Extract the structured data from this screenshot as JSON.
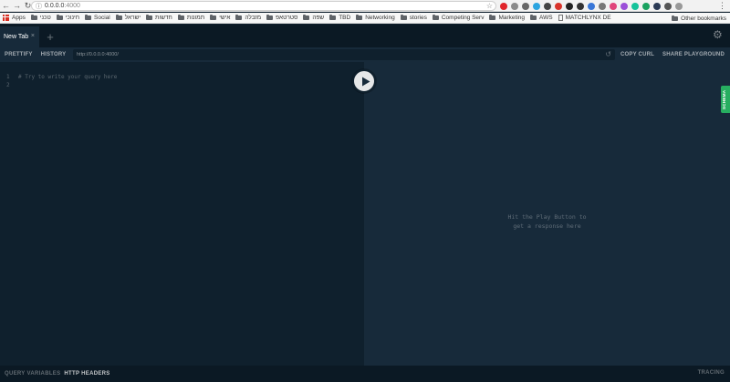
{
  "browser": {
    "url_host": "0.0.0.0",
    "url_port": ":4000",
    "extensions": [
      {
        "name": "opera-icon",
        "color": "#e0242a"
      },
      {
        "name": "ext-gray-icon",
        "color": "#8a8a8a"
      },
      {
        "name": "ext-gear-icon",
        "color": "#666666"
      },
      {
        "name": "telegram-icon",
        "color": "#2ca5e0"
      },
      {
        "name": "ext-dark-icon",
        "color": "#444444"
      },
      {
        "name": "ext-red-icon",
        "color": "#d9342b"
      },
      {
        "name": "ext-black-icon",
        "color": "#222222"
      },
      {
        "name": "ext-black2-icon",
        "color": "#333333"
      },
      {
        "name": "ext-blue-icon",
        "color": "#3a77d8"
      },
      {
        "name": "ext-gray2-icon",
        "color": "#777777"
      },
      {
        "name": "ext-pink-icon",
        "color": "#e0457b"
      },
      {
        "name": "ext-purple-icon",
        "color": "#9b4fd8"
      },
      {
        "name": "grammarly-icon",
        "color": "#15c39a"
      },
      {
        "name": "ext-green-icon",
        "color": "#1aa260"
      },
      {
        "name": "ext-navy-icon",
        "color": "#2b3a55"
      },
      {
        "name": "ext-link-icon",
        "color": "#555555"
      },
      {
        "name": "ext-gray3-icon",
        "color": "#999999"
      }
    ]
  },
  "bookmarks": {
    "apps": "Apps",
    "items": [
      "טכני",
      "חינוכי",
      "Social",
      "ישראל",
      "חדשות",
      "תמונות",
      "אישי",
      "מזבלה",
      "סטרטאפ",
      "שפה",
      "TBD",
      "Networking",
      "stories",
      "Competing Serv",
      "Marketing",
      "AWS",
      "MATCHLYNX DE"
    ],
    "other": "Other bookmarks"
  },
  "playground": {
    "tab_title": "New Tab",
    "tab_close": "×",
    "tab_add": "+",
    "prettify": "PRETTIFY",
    "history": "HISTORY",
    "endpoint": "http://0.0.0.0:4000/",
    "copy_curl": "COPY CURL",
    "share": "SHARE PLAYGROUND",
    "schema": "SCHEMA",
    "editor_lines": [
      {
        "num": "1",
        "text": "# Try to write your query here"
      },
      {
        "num": "2",
        "text": ""
      }
    ],
    "result_message": "Hit the Play Button to\nget a response here",
    "query_variables": "QUERY VARIABLES",
    "http_headers": "HTTP HEADERS",
    "tracing": "TRACING"
  }
}
